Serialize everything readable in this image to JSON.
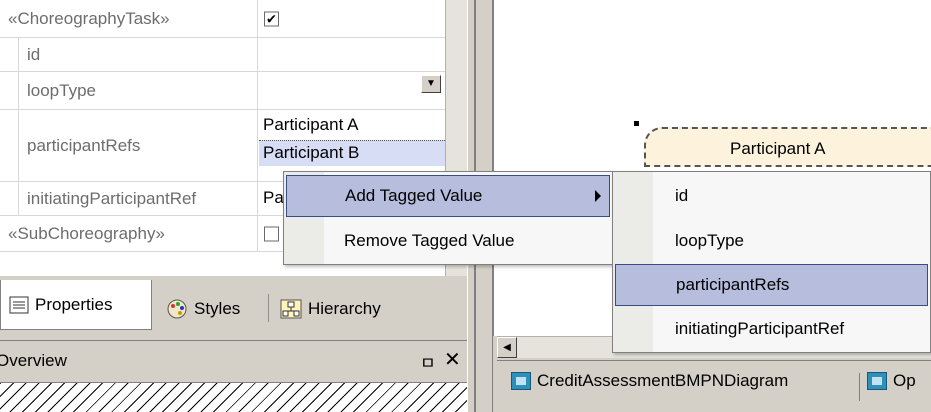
{
  "properties": {
    "rows": [
      {
        "name": "«ChoreographyTask»",
        "value": "",
        "checked": true
      },
      {
        "name": "id",
        "value": ""
      },
      {
        "name": "loopType",
        "value": ""
      },
      {
        "name": "participantRefs",
        "values": [
          "Participant A",
          "Participant B"
        ]
      },
      {
        "name": "initiatingParticipantRef",
        "value": "Pa"
      },
      {
        "name": "«SubChoreography»",
        "value": "",
        "checked": false
      }
    ]
  },
  "tabs": {
    "properties": "Properties",
    "styles": "Styles",
    "hierarchy": "Hierarchy"
  },
  "overview": {
    "title": "Overview",
    "pin": "ᵖ",
    "close": "✕"
  },
  "diagram": {
    "participant_label": "Participant A"
  },
  "context_menu": {
    "items": [
      "Add Tagged Value",
      "Remove Tagged Value"
    ],
    "submenu": [
      "id",
      "loopType",
      "participantRefs",
      "initiatingParticipantRef"
    ]
  },
  "document_tabs": [
    "CreditAssessmentBMPNDiagram",
    "Op"
  ],
  "colors": {
    "highlight": "#b6bddd",
    "selection": "#d8ddf6",
    "participant_fill": "#fdf3dc"
  }
}
